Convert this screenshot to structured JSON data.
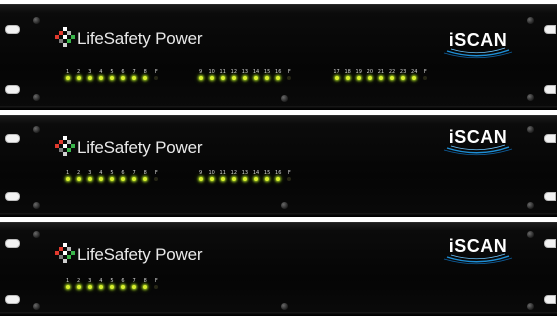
{
  "brand": "LifeSafety Power",
  "product": "iSCAN",
  "colors": {
    "led_on": "#d8ef2e",
    "led_off": "#262615",
    "chassis": "#070707"
  },
  "units": [
    {
      "banks": [
        {
          "channels": [
            "1",
            "2",
            "3",
            "4",
            "5",
            "6",
            "7",
            "8",
            "F"
          ],
          "leds": [
            1,
            1,
            1,
            1,
            1,
            1,
            1,
            1,
            0
          ]
        },
        {
          "channels": [
            "9",
            "10",
            "11",
            "12",
            "13",
            "14",
            "15",
            "16",
            "F"
          ],
          "leds": [
            1,
            1,
            1,
            1,
            1,
            1,
            1,
            1,
            0
          ]
        },
        {
          "channels": [
            "17",
            "18",
            "19",
            "20",
            "21",
            "22",
            "23",
            "24",
            "F"
          ],
          "leds": [
            1,
            1,
            1,
            1,
            1,
            1,
            1,
            1,
            0
          ]
        }
      ]
    },
    {
      "banks": [
        {
          "channels": [
            "1",
            "2",
            "3",
            "4",
            "5",
            "6",
            "7",
            "8",
            "F"
          ],
          "leds": [
            1,
            1,
            1,
            1,
            1,
            1,
            1,
            1,
            0
          ]
        },
        {
          "channels": [
            "9",
            "10",
            "11",
            "12",
            "13",
            "14",
            "15",
            "16",
            "F"
          ],
          "leds": [
            1,
            1,
            1,
            1,
            1,
            1,
            1,
            1,
            0
          ]
        }
      ]
    },
    {
      "banks": [
        {
          "channels": [
            "1",
            "2",
            "3",
            "4",
            "5",
            "6",
            "7",
            "8",
            "F"
          ],
          "leds": [
            1,
            1,
            1,
            1,
            1,
            1,
            1,
            1,
            0
          ]
        }
      ]
    }
  ]
}
